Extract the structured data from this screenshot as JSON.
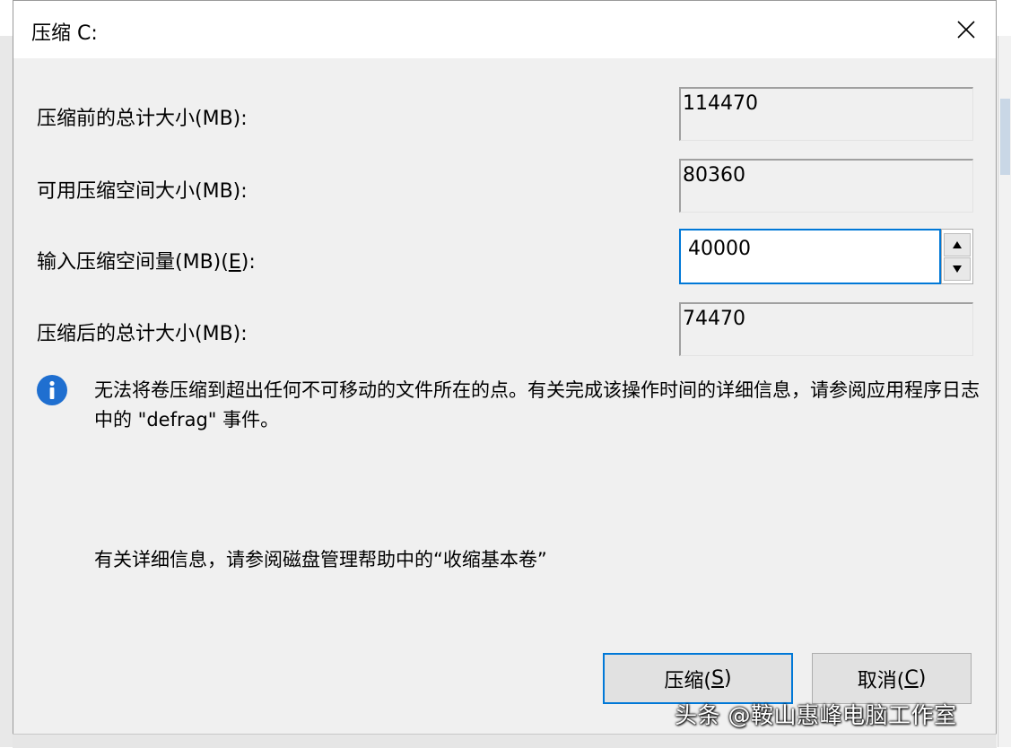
{
  "dialog": {
    "title": "压缩 C:",
    "close_icon": "close-icon"
  },
  "fields": {
    "total_before_label": "压缩前的总计大小(MB):",
    "total_before_value": "114470",
    "available_label": "可用压缩空间大小(MB):",
    "available_value": "80360",
    "amount_label_prefix": "输入压缩空间量(MB)(",
    "amount_label_key": "E",
    "amount_label_suffix": "):",
    "amount_value": "40000",
    "total_after_label": "压缩后的总计大小(MB):",
    "total_after_value": "74470"
  },
  "info": {
    "icon": "info-icon",
    "message": "无法将卷压缩到超出任何不可移动的文件所在的点。有关完成该操作时间的详细信息，请参阅应用程序日志中的 \"defrag\" 事件。",
    "help": "有关详细信息，请参阅磁盘管理帮助中的“收缩基本卷”"
  },
  "buttons": {
    "shrink_prefix": "压缩(",
    "shrink_key": "S",
    "shrink_suffix": ")",
    "cancel_prefix": "取消(",
    "cancel_key": "C",
    "cancel_suffix": ")"
  },
  "watermark": "头条 @鞍山惠峰电脑工作室",
  "colors": {
    "accent": "#0078d7",
    "info_icon": "#1f6fd0",
    "dialog_bg": "#f0f0f0"
  }
}
